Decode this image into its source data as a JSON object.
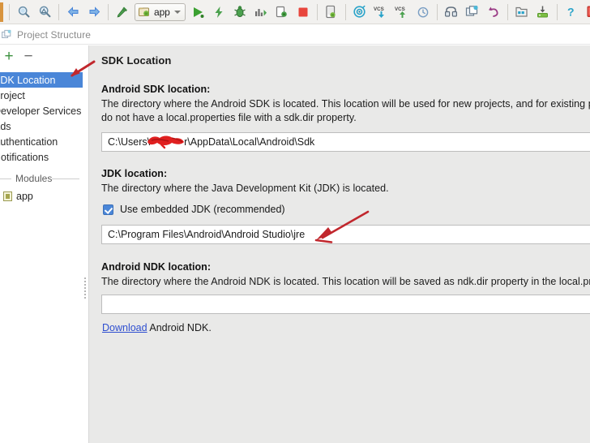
{
  "window": {
    "title": "Project Structure",
    "title_icon": "project-structure-icon"
  },
  "toolbar": {
    "items": [
      {
        "name": "search-icon",
        "label": "Search"
      },
      {
        "name": "search-structure-icon",
        "label": "Search Structurally"
      },
      {
        "name": "navigate-back-icon",
        "label": "Back"
      },
      {
        "name": "navigate-forward-icon",
        "label": "Forward"
      },
      {
        "name": "build-hammer-icon",
        "label": "Make Project"
      },
      {
        "name": "run-configuration-selector",
        "label": "app"
      },
      {
        "name": "run-icon",
        "label": "Run"
      },
      {
        "name": "apply-changes-icon",
        "label": "Apply Changes"
      },
      {
        "name": "debug-icon",
        "label": "Debug"
      },
      {
        "name": "profile-icon",
        "label": "Profile"
      },
      {
        "name": "attach-debugger-icon",
        "label": "Attach Debugger to Android Process"
      },
      {
        "name": "stop-icon",
        "label": "Stop"
      },
      {
        "name": "avd-manager-icon",
        "label": "AVD Manager"
      },
      {
        "name": "sdk-manager-icon",
        "label": "SDK Manager"
      },
      {
        "name": "vcs-update-icon",
        "label": "Update Project"
      },
      {
        "name": "vcs-commit-icon",
        "label": "Commit"
      },
      {
        "name": "vcs-history-icon",
        "label": "VCS History"
      },
      {
        "name": "gradle-sync-icon",
        "label": "Sync Project with Gradle Files"
      },
      {
        "name": "project-structure-icon",
        "label": "Project Structure"
      },
      {
        "name": "undo-icon",
        "label": "Undo"
      },
      {
        "name": "layout-inspector-icon",
        "label": "Layout Inspector"
      },
      {
        "name": "device-file-explorer-icon",
        "label": "Device File Explorer"
      },
      {
        "name": "help-icon",
        "label": "Help"
      },
      {
        "name": "device-manager-icon",
        "label": "Device Manager"
      },
      {
        "name": "user-account-icon",
        "label": "Account"
      }
    ],
    "run_config_label": "app"
  },
  "sidebar": {
    "add_label": "+",
    "remove_label": "−",
    "items": [
      {
        "label": "SDK Location",
        "selected": true
      },
      {
        "label": "Project",
        "selected": false
      },
      {
        "label": "Developer Services",
        "selected": false
      },
      {
        "label": "Ads",
        "selected": false
      },
      {
        "label": "Authentication",
        "selected": false
      },
      {
        "label": "Notifications",
        "selected": false
      }
    ],
    "group_label": "Modules",
    "modules": [
      {
        "label": "app",
        "icon": "module-icon"
      }
    ]
  },
  "main": {
    "page_title": "SDK Location",
    "sdk": {
      "label": "Android SDK location:",
      "desc_line1": "The directory where the Android SDK is located. This location will be used for new projects, and for existing projects th",
      "desc_line2": "do not have a local.properties file with a sdk.dir property.",
      "value_prefix": "C:\\Users\\",
      "value_suffix": "r\\AppData\\Local\\Android\\Sdk",
      "redacted": true
    },
    "jdk": {
      "label": "JDK location:",
      "desc_line1": "The directory where the Java Development Kit (JDK) is located.",
      "checkbox_label": "Use embedded JDK (recommended)",
      "checkbox_checked": true,
      "value": "C:\\Program Files\\Android\\Android Studio\\jre"
    },
    "ndk": {
      "label": "Android NDK location:",
      "desc_line1": "The directory where the Android NDK is located. This location will be saved as ndk.dir property in the local.properties",
      "value": "",
      "download_link": "Download",
      "download_suffix": " Android NDK."
    }
  },
  "annotations": {
    "color": "#c1272d",
    "arrow_sidebar": "arrow-pointing-to-sdk-location",
    "arrow_jdk": "arrow-pointing-to-jdk-path-field",
    "redaction_blob": "redacted-username-scribble"
  }
}
